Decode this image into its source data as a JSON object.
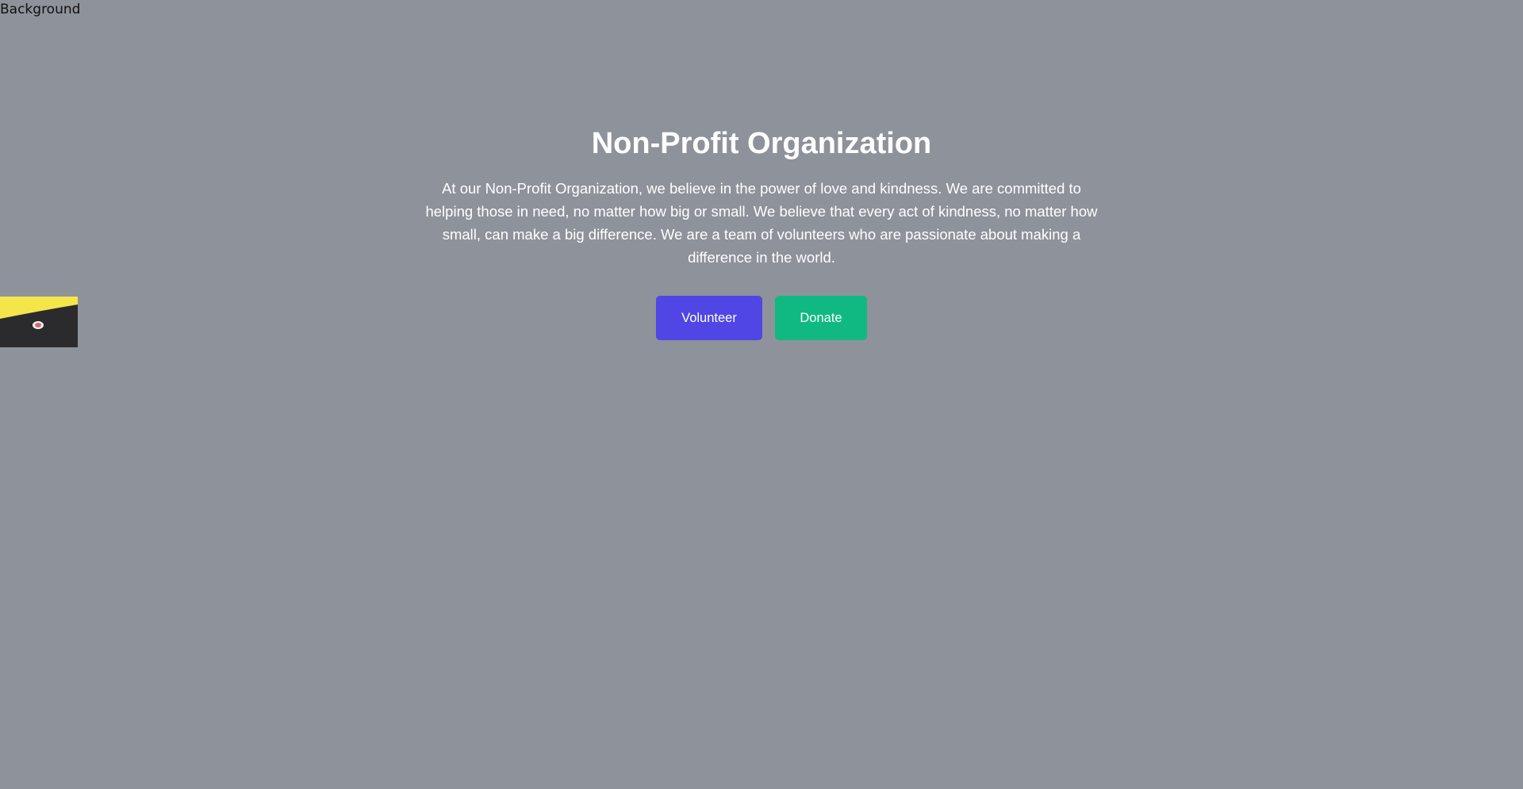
{
  "background_alt": "Background",
  "hero": {
    "title": "Non-Profit Organization",
    "description": "At our Non-Profit Organization, we believe in the power of love and kindness. We are committed to helping those in need, no matter how big or small. We believe that every act of kindness, no matter how small, can make a big difference. We are a team of volunteers who are passionate about making a difference in the world."
  },
  "buttons": {
    "volunteer_label": "Volunteer",
    "donate_label": "Donate"
  },
  "colors": {
    "page_background": "#8e929a",
    "volunteer_button": "#4f46e5",
    "donate_button": "#10b981",
    "text": "#ffffff"
  }
}
